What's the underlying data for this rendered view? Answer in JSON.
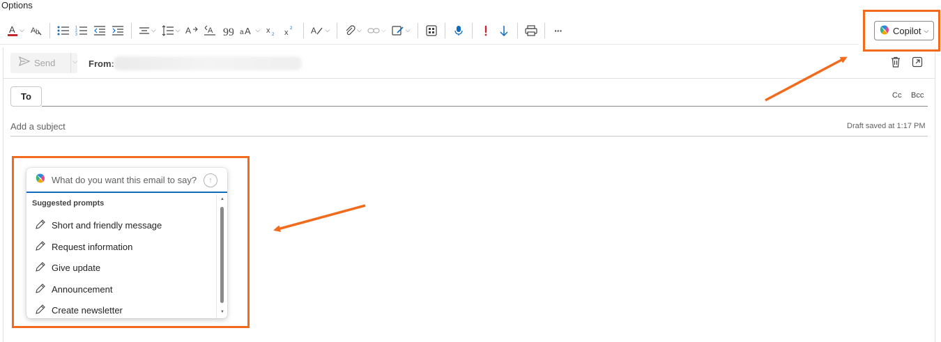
{
  "menu": {
    "options_label": "Options"
  },
  "toolbar": {
    "copilot_label": "Copilot",
    "more_label": "···",
    "format_icons": [
      "font-color-icon",
      "format-painter-icon",
      "bullets-icon",
      "numbering-icon",
      "decrease-indent-icon",
      "increase-indent-icon",
      "align-icon",
      "line-spacing-icon",
      "styles-icon",
      "clear-format-icon",
      "quote-icon",
      "change-case-icon",
      "subscript-icon",
      "superscript-icon",
      "editor-icon",
      "attach-icon",
      "link-icon",
      "signature-icon",
      "apps-icon",
      "dictate-icon",
      "importance-high-icon",
      "importance-low-icon",
      "print-icon",
      "more-icon"
    ]
  },
  "compose": {
    "send_label": "Send",
    "from_label": "From:",
    "to_label": "To",
    "cc_label": "Cc",
    "bcc_label": "Bcc",
    "subject_placeholder": "Add a subject",
    "draft_status": "Draft saved at 1:17 PM"
  },
  "copilot_panel": {
    "input_placeholder": "What do you want this email to say?",
    "suggested_title": "Suggested prompts",
    "prompts": [
      "Short and friendly message",
      "Request information",
      "Give update",
      "Announcement",
      "Create newsletter"
    ]
  },
  "colors": {
    "highlight": "#f26b1d",
    "accent": "#0f6cbd",
    "font_color_red": "#c4262e"
  }
}
